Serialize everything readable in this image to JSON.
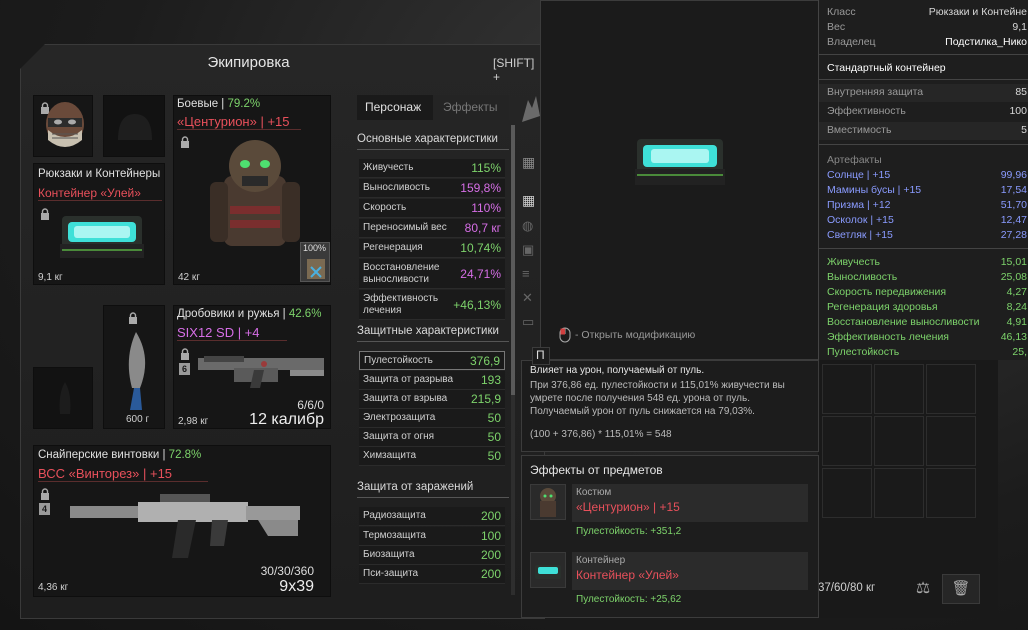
{
  "equipment": {
    "title": "Экипировка",
    "shift_hint": "[SHIFT] +",
    "backpack": {
      "title": "Рюкзаки и Контейнеры",
      "item": "Контейнер «Улей»",
      "weight": "9,1 кг"
    },
    "armor": {
      "category": "Боевые",
      "pct": "79.2%",
      "item": "«Центурион» | +15",
      "weight": "42 кг",
      "durability": "100%"
    },
    "shotgun": {
      "category": "Дробовики и ружья",
      "pct": "42.6%",
      "item": "SIX12 SD | +4",
      "mod_badge": "6",
      "ammo": "6/6/0",
      "caliber": "12 калибр",
      "weight": "2,98 кг"
    },
    "knife": {
      "weight": "600 г"
    },
    "sniper": {
      "category": "Снайперские винтовки",
      "pct": "72.8%",
      "item": "ВСС «Винторез» | +15",
      "mod_badge": "4",
      "ammo": "30/30/360",
      "caliber": "9x39",
      "weight": "4,36 кг"
    }
  },
  "stats": {
    "tabs": [
      "Персонаж",
      "Эффекты"
    ],
    "main_title": "Основные характеристики",
    "main": [
      {
        "k": "Живучесть",
        "v": "115%",
        "c": "g"
      },
      {
        "k": "Выносливость",
        "v": "159,8%",
        "c": "p"
      },
      {
        "k": "Скорость",
        "v": "110%",
        "c": "p"
      },
      {
        "k": "Переносимый вес",
        "v": "80,7 кг",
        "c": "p"
      },
      {
        "k": "Регенерация",
        "v": "10,74%",
        "c": "g"
      },
      {
        "k": "Восстановление выносливости",
        "v": "24,71%",
        "c": "p"
      },
      {
        "k": "Эффективность лечения",
        "v": "+46,13%",
        "c": "g"
      }
    ],
    "def_title": "Защитные характеристики",
    "def": [
      {
        "k": "Пулестойкость",
        "v": "376,9",
        "c": "g"
      },
      {
        "k": "Защита от разрыва",
        "v": "193",
        "c": "g"
      },
      {
        "k": "Защита от взрыва",
        "v": "215,9",
        "c": "g"
      },
      {
        "k": "Электрозащита",
        "v": "50",
        "c": "g"
      },
      {
        "k": "Защита от огня",
        "v": "50",
        "c": "g"
      },
      {
        "k": "Химзащита",
        "v": "50",
        "c": "g"
      }
    ],
    "inf_title": "Защита от заражений",
    "inf": [
      {
        "k": "Радиозащита",
        "v": "200",
        "c": "g"
      },
      {
        "k": "Термозащита",
        "v": "100",
        "c": "g"
      },
      {
        "k": "Биозащита",
        "v": "200",
        "c": "g"
      },
      {
        "k": "Пси-защита",
        "v": "200",
        "c": "g"
      }
    ]
  },
  "preview": {
    "hint": "- Открыть модификацию"
  },
  "item_tip": {
    "top": [
      {
        "l": "Класс",
        "r": "Рюкзаки и Контейне"
      },
      {
        "l": "Вес",
        "r": "9,1"
      },
      {
        "l": "Владелец",
        "r": "Подстилка_Нико"
      }
    ],
    "type": "Стандартный контейнер",
    "props": [
      {
        "l": "Внутренняя защита",
        "r": "85"
      },
      {
        "l": "Эффективность",
        "r": "100"
      },
      {
        "l": "Вместимость",
        "r": "5"
      }
    ],
    "artifacts_title": "Артефакты",
    "artifacts": [
      {
        "l": "Солнце | +15",
        "r": "99,96"
      },
      {
        "l": "Мамины бусы | +15",
        "r": "17,54"
      },
      {
        "l": "Призма | +12",
        "r": "51,70"
      },
      {
        "l": "Осколок | +15",
        "r": "12,47"
      },
      {
        "l": "Светляк | +15",
        "r": "27,28"
      }
    ],
    "bonuses": [
      {
        "l": "Живучесть",
        "r": "15,01"
      },
      {
        "l": "Выносливость",
        "r": "25,08"
      },
      {
        "l": "Скорость передвижения",
        "r": "4,27"
      },
      {
        "l": "Регенерация здоровья",
        "r": "8,24"
      },
      {
        "l": "Восстановление выносливости",
        "r": "4,91"
      },
      {
        "l": "Эффективность лечения",
        "r": "46,13"
      },
      {
        "l": "Пулестойкость",
        "r": "25,"
      }
    ]
  },
  "tooltip": {
    "heading": "П",
    "title": "Влияет на урон, получаемый от пуль.",
    "lines": [
      "При 376,86 ед. пулестойкости и 115,01% живучести вы",
      "умрете после получения 548 ед. урона от пуль.",
      "Получаемый урон от пуль снижается на 79,03%."
    ],
    "formula": "(100 + 376,86) * 115,01% = 548"
  },
  "effects": {
    "title": "Эффекты от предметов",
    "items": [
      {
        "cat": "Костюм",
        "name": "«Центурион» | +15",
        "bonus": "Пулестойкость: +351,2"
      },
      {
        "cat": "Контейнер",
        "name": "Контейнер «Улей»",
        "bonus": "Пулестойкость: +25,62"
      }
    ]
  },
  "inventory": {
    "weight": "37/60/80 кг"
  },
  "colors": {
    "green": "#7dd36b",
    "pink": "#d66ee6",
    "red": "#e8505b",
    "blue": "#8a9bff"
  }
}
